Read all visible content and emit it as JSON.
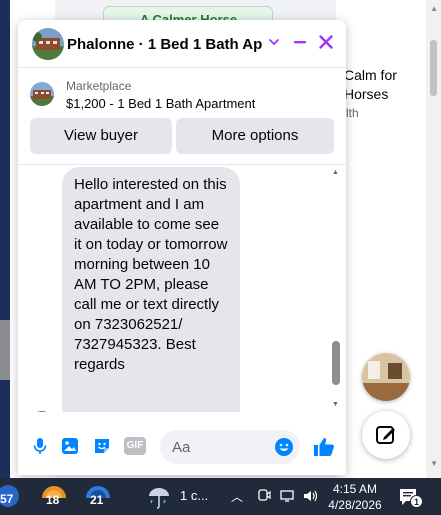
{
  "background": {
    "card_top_label": "A Calmer Horse",
    "side_title": "Calm for Horses",
    "side_subtitle": "lth"
  },
  "chat": {
    "title": "Phalonne · 1 Bed 1 Bath Ap...",
    "listing": {
      "source": "Marketplace",
      "title": "$1,200 - 1 Bed 1 Bath Apartment"
    },
    "buttons": {
      "view_buyer": "View buyer",
      "more_options": "More options"
    },
    "message": "Hello interested on this apartment and I am available to come see it on today or tomorrow morning between 10 AM TO 2PM, please call me or text directly on 7323062521/ 7327945323. Best regards",
    "composer": {
      "placeholder": "Aa",
      "gif_label": "GIF"
    },
    "accent_color": "#0084ff",
    "header_accent_color": "#a033ff"
  },
  "taskbar": {
    "apps": [
      {
        "name": "app-57",
        "badge": "57"
      },
      {
        "name": "app-18",
        "badge": "18"
      },
      {
        "name": "app-21",
        "badge": "21"
      }
    ],
    "weather": "1 c...",
    "time": "4:15 AM",
    "date": "4/28/2026",
    "notifications": "1"
  }
}
